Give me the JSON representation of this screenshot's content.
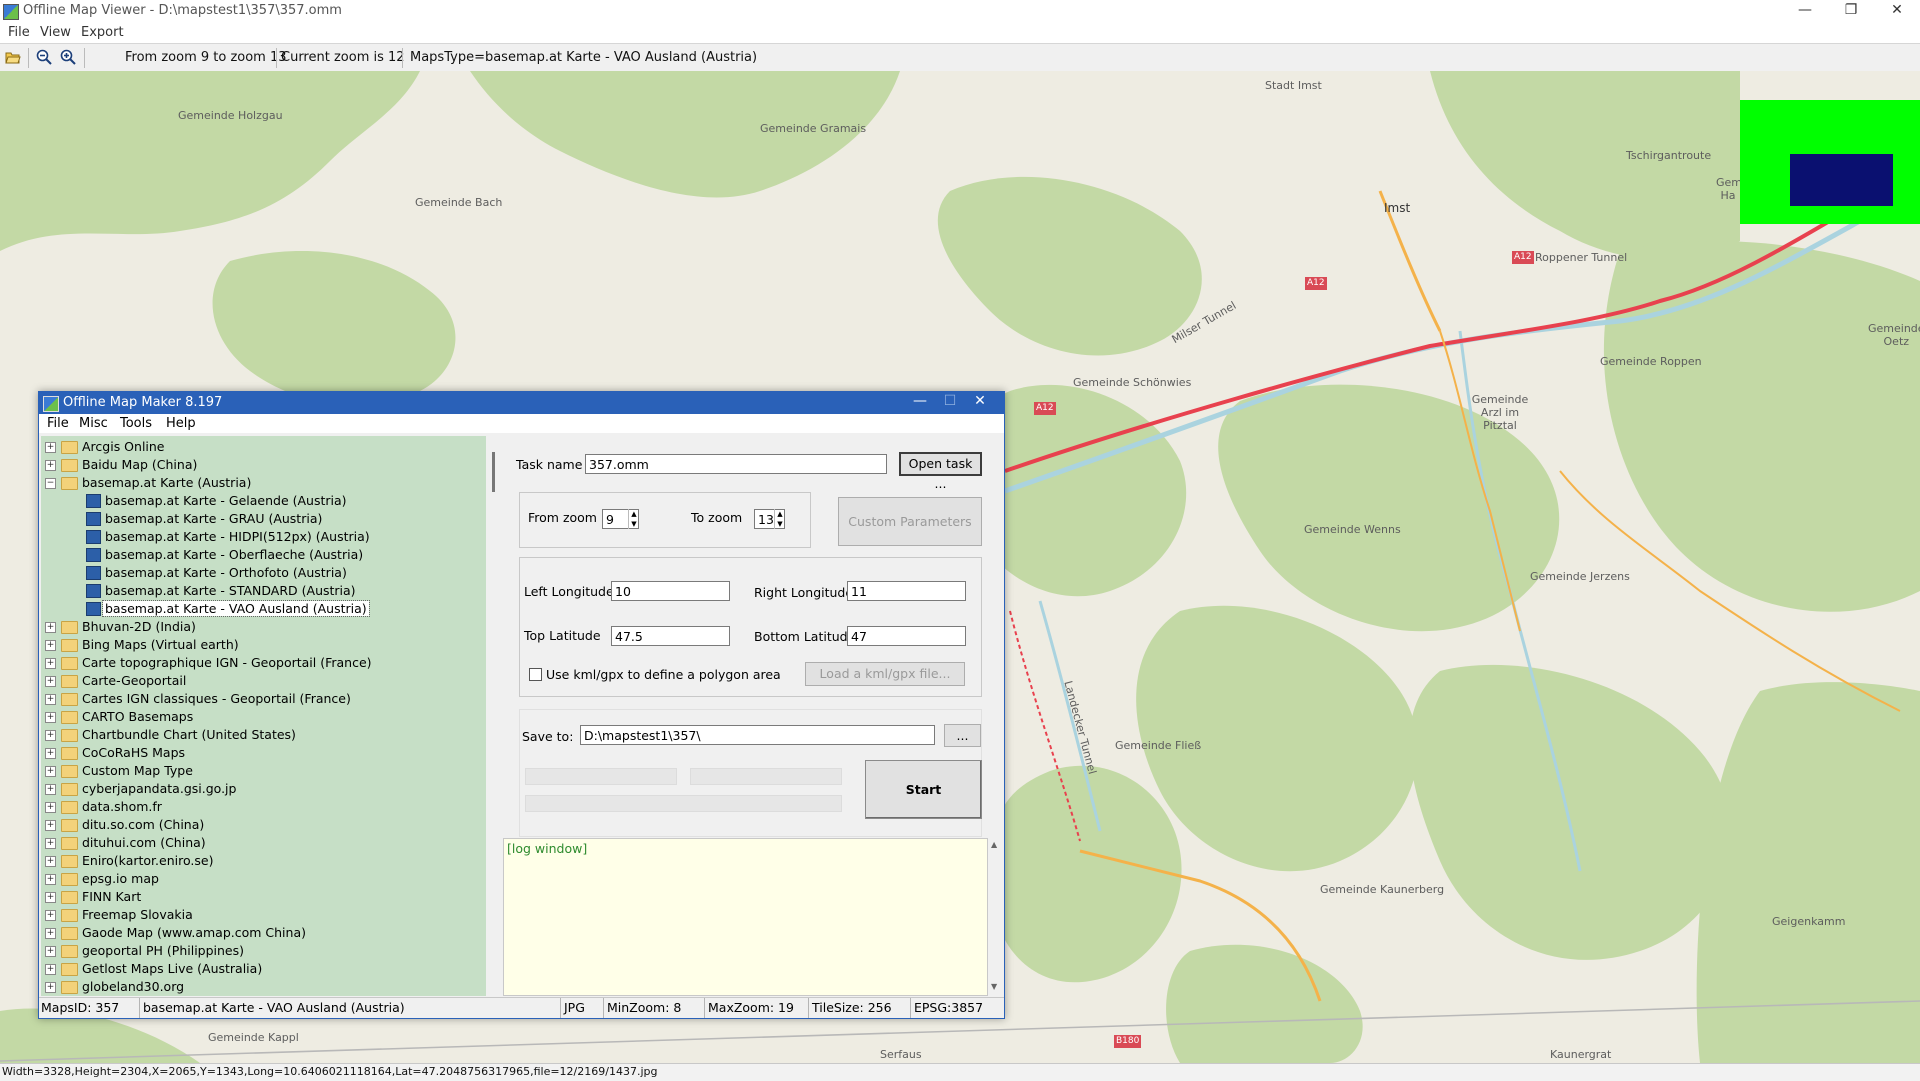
{
  "window": {
    "title": "Offline Map Viewer - D:\\mapstest1\\357\\357.omm",
    "controls": {
      "minimize": "—",
      "maximize": "❐",
      "close": "✕"
    }
  },
  "menu": [
    "File",
    "View",
    "Export"
  ],
  "toolbar": {
    "zoom_range": "From zoom 9 to zoom 13",
    "current_zoom": "Current zoom is 12",
    "maps_type": "MapsType=basemap.at Karte - VAO Ausland (Austria)"
  },
  "map": {
    "labels": [
      "Gemeinde Holzgau",
      "Gemeinde Gramais",
      "Gemeinde Bach",
      "Stadt Imst",
      "Imst",
      "Tschirgantroute",
      "A12",
      "A12",
      "Roppener Tunnel",
      "Gemeinde Schönwies",
      "Milser Tunnel",
      "A12",
      "Gemeinde Roppen",
      "Gemeinde Arzl im Pitztal",
      "Gemeinde Oetz",
      "Landecker Tunnel",
      "Gemeinde Wenns",
      "Gemeinde Jerzens",
      "Gemeinde Fließ",
      "Gemeinde Kaunerberg",
      "Geigenkamm",
      "Gemeinde Kappl",
      "Serfaus",
      "B180",
      "Kaunergrat",
      "Gem Ha"
    ],
    "overview_colors": {
      "background": "#00ff00",
      "viewport": "#0a1070"
    }
  },
  "status_bar": {
    "text": "Width=3328,Height=2304,X=2065,Y=1343,Long=10.6406021118164,Lat=47.2048756317965,file=12/2169/1437.jpg"
  },
  "dialog": {
    "title": "Offline Map Maker 8.197",
    "menu": [
      "File",
      "Misc",
      "Tools",
      "Help"
    ],
    "tree": {
      "items": [
        {
          "label": "Arcgis Online",
          "level": 0,
          "expanded": false
        },
        {
          "label": "Baidu Map (China)",
          "level": 0,
          "expanded": false
        },
        {
          "label": "basemap.at Karte (Austria)",
          "level": 0,
          "expanded": true
        },
        {
          "label": "basemap.at Karte - Gelaende (Austria)",
          "level": 1
        },
        {
          "label": "basemap.at Karte - GRAU (Austria)",
          "level": 1
        },
        {
          "label": "basemap.at Karte - HIDPI(512px) (Austria)",
          "level": 1
        },
        {
          "label": "basemap.at Karte - Oberflaeche (Austria)",
          "level": 1
        },
        {
          "label": "basemap.at Karte - Orthofoto (Austria)",
          "level": 1
        },
        {
          "label": "basemap.at Karte - STANDARD (Austria)",
          "level": 1
        },
        {
          "label": "basemap.at Karte - VAO Ausland (Austria)",
          "level": 1,
          "selected": true
        },
        {
          "label": "Bhuvan-2D (India)",
          "level": 0,
          "expanded": false
        },
        {
          "label": "Bing Maps (Virtual earth)",
          "level": 0,
          "expanded": false
        },
        {
          "label": "Carte topographique IGN - Geoportail (France)",
          "level": 0,
          "expanded": false
        },
        {
          "label": "Carte-Geoportail",
          "level": 0,
          "expanded": false
        },
        {
          "label": "Cartes IGN classiques - Geoportail (France)",
          "level": 0,
          "expanded": false
        },
        {
          "label": "CARTO Basemaps",
          "level": 0,
          "expanded": false
        },
        {
          "label": "Chartbundle Chart (United States)",
          "level": 0,
          "expanded": false
        },
        {
          "label": "CoCoRaHS Maps",
          "level": 0,
          "expanded": false
        },
        {
          "label": "Custom Map Type",
          "level": 0,
          "expanded": false
        },
        {
          "label": "cyberjapandata.gsi.go.jp",
          "level": 0,
          "expanded": false
        },
        {
          "label": "data.shom.fr",
          "level": 0,
          "expanded": false
        },
        {
          "label": "ditu.so.com (China)",
          "level": 0,
          "expanded": false
        },
        {
          "label": "dituhui.com (China)",
          "level": 0,
          "expanded": false
        },
        {
          "label": "Eniro(kartor.eniro.se)",
          "level": 0,
          "expanded": false
        },
        {
          "label": "epsg.io map",
          "level": 0,
          "expanded": false
        },
        {
          "label": "FINN Kart",
          "level": 0,
          "expanded": false
        },
        {
          "label": "Freemap Slovakia",
          "level": 0,
          "expanded": false
        },
        {
          "label": "Gaode Map (www.amap.com China)",
          "level": 0,
          "expanded": false
        },
        {
          "label": "geoportal PH (Philippines)",
          "level": 0,
          "expanded": false
        },
        {
          "label": "Getlost Maps Live (Australia)",
          "level": 0,
          "expanded": false
        },
        {
          "label": "globeland30.org",
          "level": 0,
          "expanded": false
        }
      ]
    },
    "task": {
      "label": "Task name",
      "value": "357.omm",
      "open_button": "Open task ..."
    },
    "zoom": {
      "from_label": "From zoom",
      "from_value": "9",
      "to_label": "To zoom",
      "to_value": "13",
      "custom_button": "Custom Parameters"
    },
    "coords": {
      "left_lon_label": "Left Longitude",
      "left_lon": "10",
      "right_lon_label": "Right Longitude",
      "right_lon": "11",
      "top_lat_label": "Top Latitude",
      "top_lat": "47.5",
      "bottom_lat_label": "Bottom Latitude",
      "bottom_lat": "47",
      "kml_checkbox_label": "Use kml/gpx to define a polygon area",
      "kml_checked": false,
      "kml_button": "Load a kml/gpx file..."
    },
    "save": {
      "label": "Save to:",
      "value": "D:\\mapstest1\\357\\",
      "browse": "..."
    },
    "start_button": "Start",
    "log": {
      "text": "[log window]"
    },
    "status": {
      "maps_id": "MapsID: 357",
      "map_name": "basemap.at Karte - VAO Ausland (Austria)",
      "format": "JPG",
      "min_zoom": "MinZoom: 8",
      "max_zoom": "MaxZoom: 19",
      "tile_size": "TileSize: 256",
      "epsg": "EPSG:3857"
    }
  }
}
